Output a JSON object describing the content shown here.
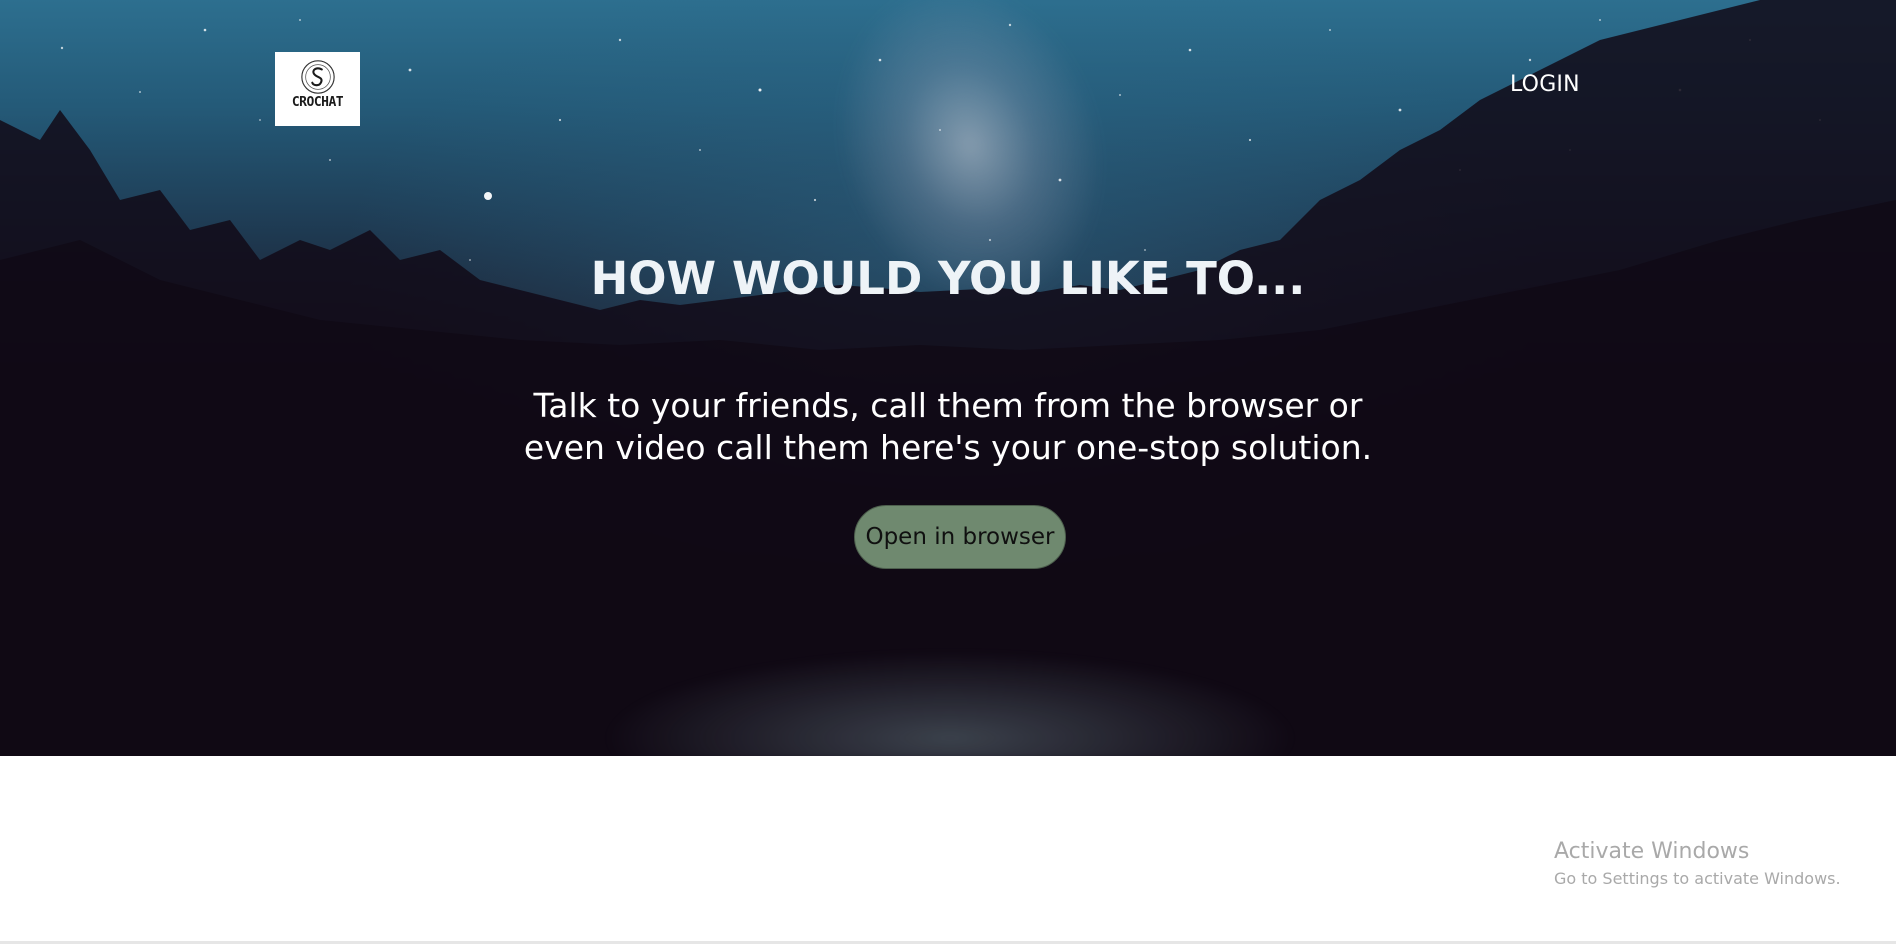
{
  "header": {
    "logo_text": "CROCHAT",
    "login_label": "LOGIN"
  },
  "hero": {
    "headline": "HOW WOULD YOU LIKE TO...",
    "subtitle": "Talk to your friends, call them from the browser or even video call them here's your one-stop solution.",
    "cta_label": "Open in browser"
  },
  "watermark": {
    "title": "Activate Windows",
    "subtitle": "Go to Settings to activate Windows."
  },
  "colors": {
    "cta_background": "#6f896f",
    "headline": "#eef3f7",
    "watermark": "#a9a9a9"
  },
  "icons": {
    "logo": "crochat-logo-icon"
  }
}
